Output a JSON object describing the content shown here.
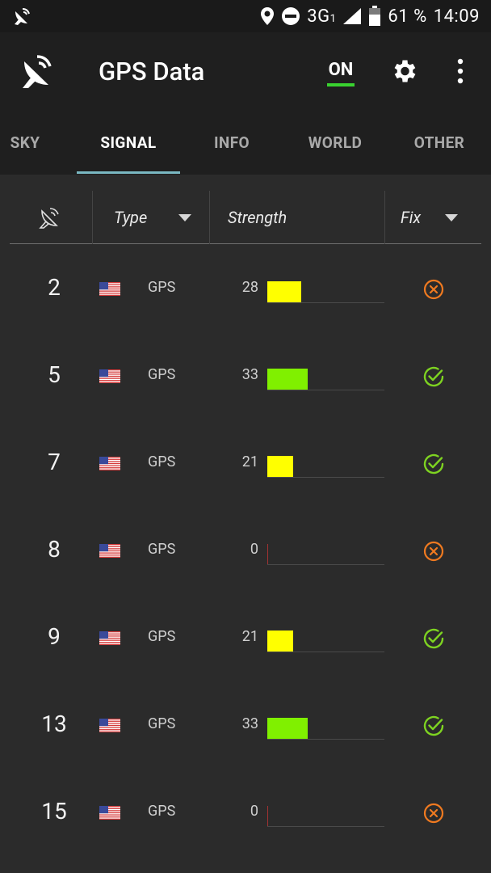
{
  "status_bar": {
    "network": "3G",
    "network_sub": "1",
    "battery": "61 %",
    "time": "14:09"
  },
  "app": {
    "title": "GPS Data",
    "toggle_label": "ON"
  },
  "tabs": [
    {
      "label": "SKY",
      "active": false
    },
    {
      "label": "SIGNAL",
      "active": true
    },
    {
      "label": "INFO",
      "active": false
    },
    {
      "label": "WORLD",
      "active": false
    },
    {
      "label": "OTHER",
      "active": false
    }
  ],
  "columns": {
    "type": "Type",
    "strength": "Strength",
    "fix": "Fix"
  },
  "colors": {
    "strong": "#80f000",
    "medium": "#ffff00",
    "fix_ok": "#7ed321",
    "fix_no": "#f07a20",
    "tab_indicator": "#7ab8c2",
    "toggle_on": "#39d230"
  },
  "satellites": [
    {
      "prn": "2",
      "type": "GPS",
      "strength": "28",
      "fix": false
    },
    {
      "prn": "5",
      "type": "GPS",
      "strength": "33",
      "fix": true
    },
    {
      "prn": "7",
      "type": "GPS",
      "strength": "21",
      "fix": true
    },
    {
      "prn": "8",
      "type": "GPS",
      "strength": "0",
      "fix": false
    },
    {
      "prn": "9",
      "type": "GPS",
      "strength": "21",
      "fix": true
    },
    {
      "prn": "13",
      "type": "GPS",
      "strength": "33",
      "fix": true
    },
    {
      "prn": "15",
      "type": "GPS",
      "strength": "0",
      "fix": false
    }
  ]
}
